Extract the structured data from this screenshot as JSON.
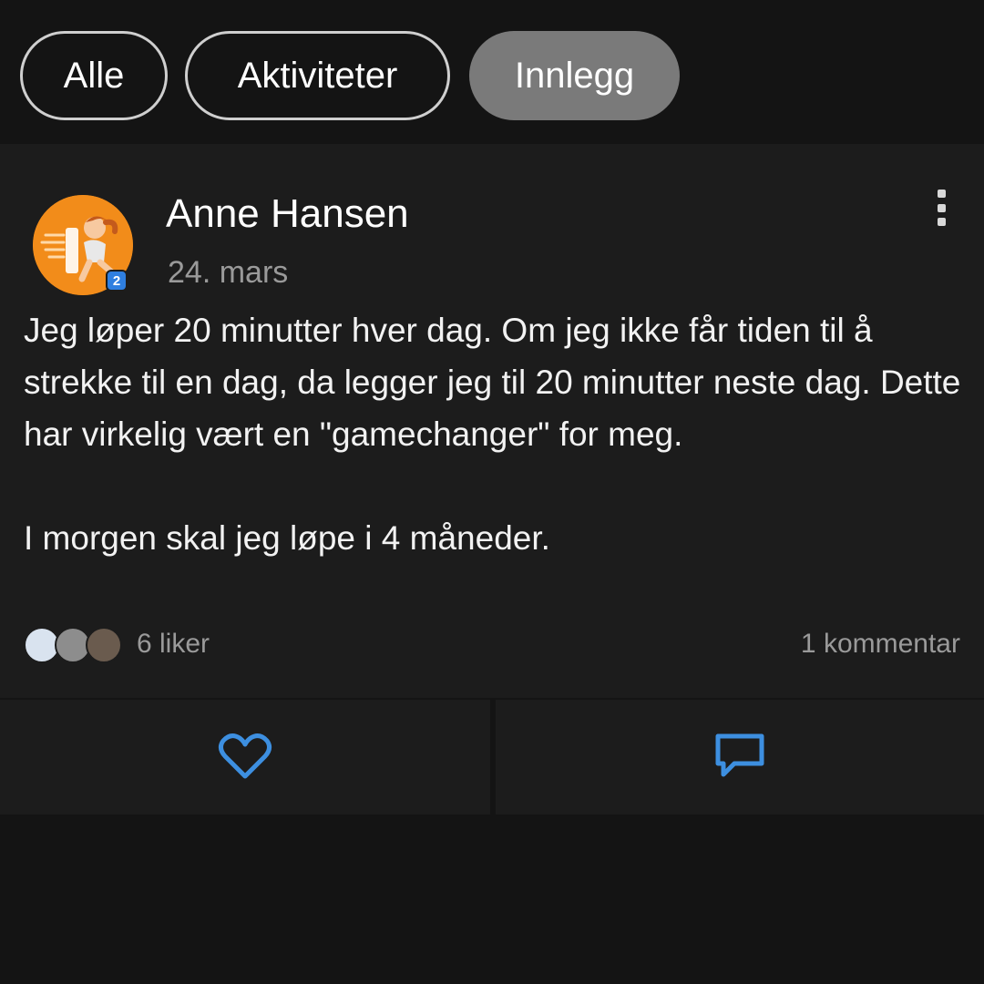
{
  "filters": {
    "all_label": "Alle",
    "activities_label": "Aktiviteter",
    "posts_label": "Innlegg",
    "active": "Innlegg"
  },
  "post": {
    "author": "Anne Hansen",
    "date": "24. mars",
    "avatar_badge": "2",
    "paragraphs": [
      "Jeg løper 20 minutter hver dag. Om jeg ikke får tiden til å strekke til en dag, da legger jeg til 20 minutter neste dag. Dette har virkelig vært en \"gamechanger\" for meg.",
      "I morgen skal jeg løpe i 4 måneder."
    ],
    "likes_label": "6 liker",
    "comments_label": "1 kommentar"
  },
  "icons": {
    "like": "heart-icon",
    "comment": "comment-bubble-icon",
    "more": "more-vertical-icon"
  },
  "colors": {
    "accent": "#3d8fe0",
    "avatar_bg": "#f28c1a",
    "active_chip": "#7a7a7a"
  }
}
